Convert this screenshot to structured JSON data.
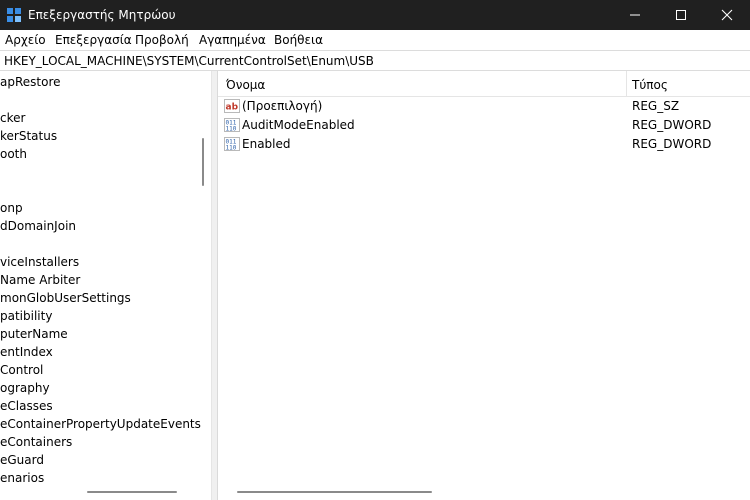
{
  "window": {
    "title": "Επεξεργαστής Μητρώου"
  },
  "menu": [
    "Αρχείο",
    "Επεξεργασία",
    "Προβολή",
    "Αγαπημένα",
    "Βοήθεια"
  ],
  "address": "HKEY_LOCAL_MACHINE\\SYSTEM\\CurrentControlSet\\Enum\\USB",
  "tree": {
    "items": [
      "apRestore",
      "",
      "cker",
      "kerStatus",
      "ooth",
      "",
      "",
      "onp",
      "dDomainJoin",
      "",
      "viceInstallers",
      "Name Arbiter",
      "monGlobUserSettings",
      "patibility",
      "puterName",
      "entIndex",
      "Control",
      "ography",
      "eClasses",
      "eContainerPropertyUpdateEvents",
      "eContainers",
      "eGuard",
      "enarios"
    ]
  },
  "list": {
    "headers": {
      "name": "Όνομα",
      "type": "Τύπος"
    },
    "rows": [
      {
        "name": "(Προεπιλογή)",
        "type": "REG_SZ",
        "icon": "string-value-icon"
      },
      {
        "name": "AuditModeEnabled",
        "type": "REG_DWORD",
        "icon": "binary-value-icon"
      },
      {
        "name": "Enabled",
        "type": "REG_DWORD",
        "icon": "binary-value-icon"
      }
    ]
  },
  "colors": {
    "titlebar": "#202020",
    "string_icon": "#c0392b",
    "binary_icon": "#2a5ea8"
  }
}
